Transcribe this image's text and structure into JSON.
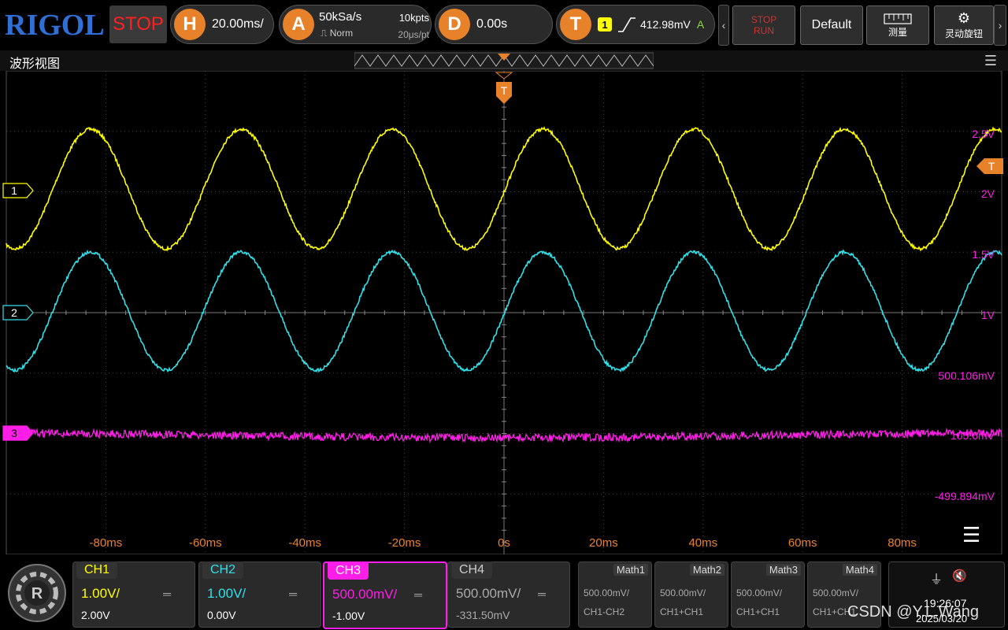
{
  "brand": "RIGOL",
  "run_state": "STOP",
  "horizontal": {
    "badge": "H",
    "scale": "20.00ms/"
  },
  "acquire": {
    "badge": "A",
    "rate": "50kSa/s",
    "depth": "10kpts",
    "mode": "Norm",
    "interval": "20μs/pt"
  },
  "delay": {
    "badge": "D",
    "value": "0.00s"
  },
  "trigger": {
    "badge": "T",
    "source": "1",
    "level": "412.98mV",
    "mode": "A"
  },
  "buttons": {
    "stop_run_1": "STOP",
    "stop_run_2": "RUN",
    "default": "Default",
    "measure": "测量",
    "knob": "灵动旋钮"
  },
  "window_title": "波形视图",
  "trigger_marker": "T",
  "channel_markers": [
    "1",
    "2",
    "3"
  ],
  "right_labels": [
    "2.5V",
    "2V",
    "1.5V",
    "1V",
    "500.106mV",
    "105.6mV",
    "-499.894mV"
  ],
  "time_labels": [
    "-80ms",
    "-60ms",
    "-40ms",
    "-20ms",
    "0s",
    "20ms",
    "40ms",
    "60ms",
    "80ms"
  ],
  "channels": [
    {
      "name": "CH1",
      "scale": "1.00V/",
      "offset": "2.00V",
      "color": "#ffff00"
    },
    {
      "name": "CH2",
      "scale": "1.00V/",
      "offset": "0.00V",
      "color": "#33dfe8"
    },
    {
      "name": "CH3",
      "scale": "500.00mV/",
      "offset": "-1.00V",
      "color": "#ff1ee8"
    },
    {
      "name": "CH4",
      "scale": "500.00mV/",
      "offset": "-331.50mV",
      "color": "#888888"
    }
  ],
  "math": [
    {
      "name": "Math1",
      "scale": "500.00mV/",
      "expr": "CH1-CH2"
    },
    {
      "name": "Math2",
      "scale": "500.00mV/",
      "expr": "CH1+CH1"
    },
    {
      "name": "Math3",
      "scale": "500.00mV/",
      "expr": "CH1+CH1"
    },
    {
      "name": "Math4",
      "scale": "500.00mV/",
      "expr": "CH1+CH1"
    }
  ],
  "status": {
    "time": "19:26:07",
    "date": "2025/03/20"
  },
  "watermark": "CSDN @Y.L.Wang",
  "colors": {
    "ch1": "#ffff00",
    "ch2": "#33dfe8",
    "ch3": "#ff1ee8",
    "accent": "#e8822a",
    "label_time": "#e8822a",
    "label_right": "#ff1ee8"
  }
}
